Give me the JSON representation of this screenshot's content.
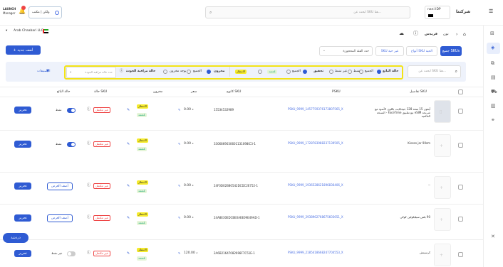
{
  "topbar": {
    "brand": "شركتنا",
    "user_name": "nani IDP",
    "search_placeholder": "ابحث عن SKU هنا...",
    "company": "ولكن | مكتب",
    "launch_line1": "LAUNCH",
    "launch_line2": "Manager"
  },
  "rail": {
    "icons": [
      "grid-icon",
      "tag-icon",
      "box-icon",
      "file-icon",
      "truck-icon",
      "chart-icon",
      "link-icon",
      "close-icon"
    ]
  },
  "header": {
    "breadcrumb_home": "نون",
    "breadcrumb_current": "فريدس",
    "store_name": "Arab Chaabari LLC",
    "add_button": "+ أضف جديد"
  },
  "tabs": {
    "all": "جميع SKUs",
    "labeled": "أنواع SKU الحية",
    "no_stock": "SKU غير حية",
    "select_placeholder": "حدد الفئة المحجوزة"
  },
  "filters": {
    "search_placeholder": "ابحث عن SKU هنا...",
    "label_status": "حالة البائع",
    "opt_all": "الجميع",
    "opt_active": "نشط",
    "opt_inactive": "غير نشط",
    "label_ready": "تحقيق",
    "opt_all2": "الجميع",
    "badge_green": "مُعتمد",
    "badge_yellow": "الانتظار",
    "label_stock": "مخزون",
    "opt_all3": "الجميع",
    "opt_instock": "يوجد مخزون",
    "label_price": "حالة مراقبة الجودة",
    "opt_price": "حدد حالة مراقبة الجودة",
    "settings_label": "التصنيفات"
  },
  "table": {
    "headers": {
      "details": "تفاصيل SKU",
      "psku": "PSKU",
      "partner_sku": "كاتوج SKU",
      "price": "سعر",
      "stock": "مخزون",
      "sku_status": "حالة SKU",
      "seller_status": "حالة البائع"
    },
    "rows": [
      {
        "title": "آيفون 15 سعة 128 جيجابايت باللون الأسود مع شريحة eSIM مع تطبيق FaceTime - النسخة العالمية",
        "psku": "PSKU_9999_1457759376173807565_X",
        "partner": "15534532989",
        "price": "0.00 د",
        "badge1": "الانتظار",
        "badge2": "مُعتمد",
        "status": "غير مكتمل",
        "seller": "نشط",
        "action": "تحرير",
        "has_offer": false
      },
      {
        "title": "Kissan jar 90zm",
        "psku": "PSKU_9999_1728783988237139505_X",
        "partner": "3306869030601131098IC3-1",
        "price": "0.00 د",
        "badge1": "الانتظار",
        "badge2": "مُعتمد",
        "status": "غير مكتمل",
        "seller": "نشط",
        "action": "تحرير",
        "has_offer": false
      },
      {
        "title": "--",
        "psku": "PSKU_9999_1936528621896836406_X",
        "partner": "24F0D02B80542DCDC2E752-1",
        "price": "0.00 د",
        "badge1": "الانتظار",
        "badge2": "مُعتمد",
        "status": "غير مكتمل",
        "seller": "",
        "action": "تحرير",
        "has_offer": true,
        "offer": "أضف العرض"
      },
      {
        "title": "90 بلس سيليكولين كوكي",
        "psku": "PSKU_9999_2938962768675603651_X",
        "partner": "24A8E30EDCBE0AEE09E49AD-1",
        "price": "0.00 د",
        "badge1": "الانتظار",
        "badge2": "مُعتمد",
        "status": "غير مكتمل",
        "seller": "",
        "action": "تحرير",
        "has_offer": true,
        "offer": "أضف العرض"
      },
      {
        "title": "كرسيتش",
        "psku": "PSKU_9999_2185418668247704553_X",
        "partner": "2A6B21647082698F7C51E-1",
        "price": "120.00 د",
        "badge1": "الانتظار",
        "badge2": "مُعتمد",
        "status": "غير مكتمل",
        "seller": "غير نشط",
        "action": "تحرير",
        "has_offer": false
      }
    ]
  },
  "chat": {
    "label": "دردشة"
  },
  "colors": {
    "accent": "#2f5bd3",
    "highlight": "#f6eb2b",
    "filter_bg": "#eef2fb"
  }
}
